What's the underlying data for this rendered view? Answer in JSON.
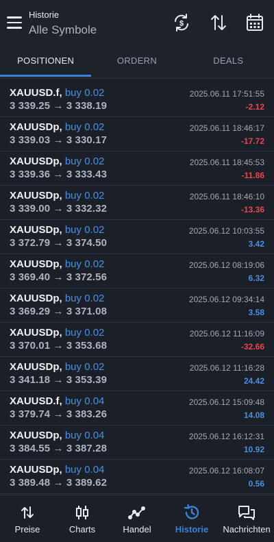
{
  "header": {
    "subtitle": "Historie",
    "title": "Alle Symbole"
  },
  "tabs": [
    {
      "label": "POSITIONEN",
      "active": true
    },
    {
      "label": "ORDERN",
      "active": false
    },
    {
      "label": "DEALS",
      "active": false
    }
  ],
  "trades": [
    {
      "symbol": "XAUUSD.f,",
      "side": "buy 0.02",
      "prices": "3 339.25 → 3 338.19",
      "time": "2025.06.11 17:51:55",
      "profit": "-2.12",
      "sign": "neg"
    },
    {
      "symbol": "XAUUSDp,",
      "side": "buy 0.02",
      "prices": "3 339.03 → 3 330.17",
      "time": "2025.06.11 18:46:17",
      "profit": "-17.72",
      "sign": "neg"
    },
    {
      "symbol": "XAUUSDp,",
      "side": "buy 0.02",
      "prices": "3 339.36 → 3 333.43",
      "time": "2025.06.11 18:45:53",
      "profit": "-11.86",
      "sign": "neg"
    },
    {
      "symbol": "XAUUSDp,",
      "side": "buy 0.02",
      "prices": "3 339.00 → 3 332.32",
      "time": "2025.06.11 18:46:10",
      "profit": "-13.36",
      "sign": "neg"
    },
    {
      "symbol": "XAUUSDp,",
      "side": "buy 0.02",
      "prices": "3 372.79 → 3 374.50",
      "time": "2025.06.12 10:03:55",
      "profit": "3.42",
      "sign": "pos"
    },
    {
      "symbol": "XAUUSDp,",
      "side": "buy 0.02",
      "prices": "3 369.40 → 3 372.56",
      "time": "2025.06.12 08:19:06",
      "profit": "6.32",
      "sign": "pos"
    },
    {
      "symbol": "XAUUSDp,",
      "side": "buy 0.02",
      "prices": "3 369.29 → 3 371.08",
      "time": "2025.06.12 09:34:14",
      "profit": "3.58",
      "sign": "pos"
    },
    {
      "symbol": "XAUUSDp,",
      "side": "buy 0.02",
      "prices": "3 370.01 → 3 353.68",
      "time": "2025.06.12 11:16:09",
      "profit": "-32.66",
      "sign": "neg"
    },
    {
      "symbol": "XAUUSDp,",
      "side": "buy 0.02",
      "prices": "3 341.18 → 3 353.39",
      "time": "2025.06.12 11:16:28",
      "profit": "24.42",
      "sign": "pos"
    },
    {
      "symbol": "XAUUSD.f,",
      "side": "buy 0.04",
      "prices": "3 379.74 → 3 383.26",
      "time": "2025.06.12 15:09:48",
      "profit": "14.08",
      "sign": "pos"
    },
    {
      "symbol": "XAUUSDp,",
      "side": "buy 0.04",
      "prices": "3 384.55 → 3 387.28",
      "time": "2025.06.12 16:12:31",
      "profit": "10.92",
      "sign": "pos"
    },
    {
      "symbol": "XAUUSDp,",
      "side": "buy 0.04",
      "prices": "3 389.48 → 3 389.62",
      "time": "2025.06.12 16:08:07",
      "profit": "0.56",
      "sign": "pos"
    }
  ],
  "bottom_nav": [
    {
      "label": "Preise",
      "icon": "quotes-arrows-icon",
      "active": false
    },
    {
      "label": "Charts",
      "icon": "candlestick-icon",
      "active": false
    },
    {
      "label": "Handel",
      "icon": "trade-line-icon",
      "active": false
    },
    {
      "label": "Historie",
      "icon": "history-clock-icon",
      "active": true
    },
    {
      "label": "Nachrichten",
      "icon": "chat-bubbles-icon",
      "active": false
    }
  ],
  "colors": {
    "background": "#1b2028",
    "accent": "#3b82d8",
    "buy": "#4a90e2",
    "loss": "#e5484d"
  }
}
